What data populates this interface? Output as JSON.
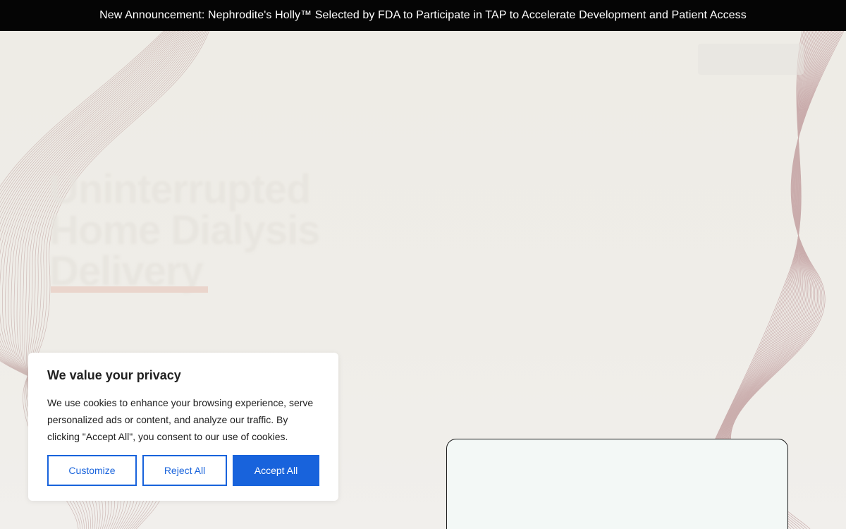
{
  "announcement": {
    "text": "New Announcement: Nephrodite's Holly™ Selected by FDA to Participate in TAP to Accelerate Development and Patient Access"
  },
  "hero": {
    "headline_lines": [
      "Uninterrupted",
      "Home Dialysis",
      "Delivery"
    ]
  },
  "cookie_banner": {
    "title": "We value your privacy",
    "body": "We use cookies to enhance your browsing experience, serve personalized ads or content, and analyze our traffic. By clicking \"Accept All\", you consent to our use of cookies.",
    "customize_label": "Customize",
    "reject_label": "Reject All",
    "accept_label": "Accept All"
  },
  "colors": {
    "accent_blue": "#1863dc",
    "announcement_bg": "#050505",
    "page_bg": "#eeece6",
    "wave_line": "#c9a9a6"
  }
}
